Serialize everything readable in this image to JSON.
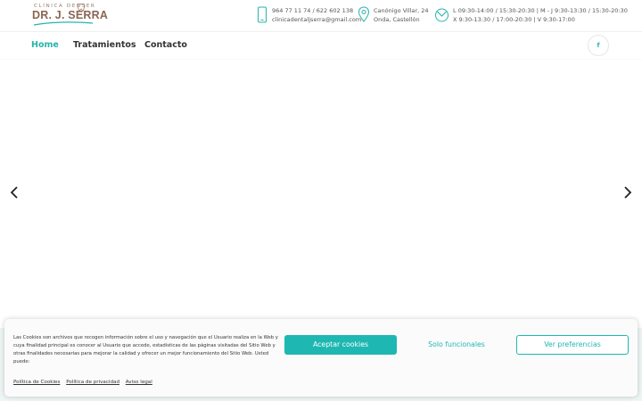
{
  "logo": {
    "line1": "CLÍNICA DENSER",
    "line2": "DR. J. SERRA"
  },
  "contact": {
    "phone": "964 77 11 74 / 622 602 138",
    "email": "clinicadentaljserra@gmail.com",
    "address_line1": "Canónigo Villar, 24",
    "address_line2": "Onda, Castellón",
    "hours_line1": "L 09:30-14:00 / 15:30-20:30 | M - J 9:30-13:30 / 15:30-20:30",
    "hours_line2": "X 9:30-13:30 / 17:00-20:30 | V 9:30-17:00"
  },
  "nav": {
    "items": [
      {
        "label": "Home",
        "active": true
      },
      {
        "label": "Tratamientos",
        "active": false
      },
      {
        "label": "Contacto",
        "active": false
      }
    ],
    "social": "f"
  },
  "colors": {
    "accent": "#27b3ad",
    "logo_brown": "#8b6553"
  },
  "icons": {
    "prev": "chevron-left-icon",
    "next": "chevron-right-icon",
    "phone": "phone-icon",
    "location": "location-pin-icon",
    "clock": "clock-icon"
  },
  "cookie": {
    "message": "Las Cookies son archivos que recogen información sobre el uso y navegación que el Usuario realiza en la Web y cuya finalidad principal es conocer al Usuario que accede, estadísticas de las páginas visitadas del Sitio Web y otras finalidades necesarias para mejorar la calidad y ofrecer un mejor funcionamiento del Sitio Web. Usted puede:",
    "accept": "Aceptar cookies",
    "functional": "Solo funcionales",
    "preferences": "Ver preferencias",
    "links": [
      "Política de Cookies",
      "Política de privacidad",
      "Aviso legal"
    ]
  }
}
